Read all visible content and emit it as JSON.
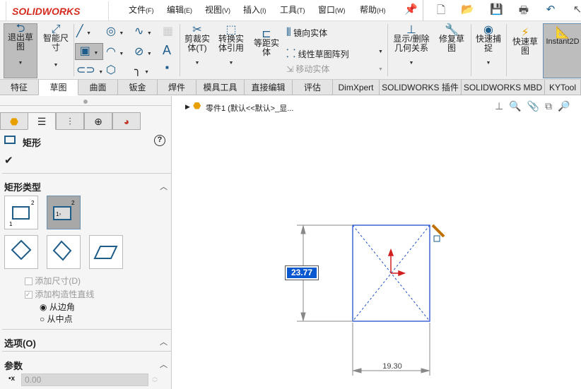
{
  "app": {
    "logo": "SOLIDWORKS"
  },
  "menu": [
    {
      "label": "文件",
      "key": "(F)"
    },
    {
      "label": "编辑",
      "key": "(E)"
    },
    {
      "label": "视图",
      "key": "(V)"
    },
    {
      "label": "插入",
      "key": "(I)"
    },
    {
      "label": "工具",
      "key": "(T)"
    },
    {
      "label": "窗口",
      "key": "(W)"
    },
    {
      "label": "帮助",
      "key": "(H)"
    }
  ],
  "ribbon": {
    "exit_sketch": "退出草图",
    "smart_dim": "智能尺寸",
    "trim": "剪裁实体(T)",
    "convert": "转换实体引用",
    "offset": "等距实体",
    "mirror": "镜向实体",
    "linear_pattern": "线性草图阵列",
    "move": "移动实体",
    "display_relations": "显示/删除几何关系",
    "repair": "修复草图",
    "quick_snaps": "快速捕捉",
    "rapid_sketch": "快速草图",
    "instant2d": "Instant2D"
  },
  "tabs": [
    "特征",
    "草图",
    "曲面",
    "钣金",
    "焊件",
    "模具工具",
    "直接编辑",
    "评估",
    "DimXpert",
    "SOLIDWORKS 插件",
    "SOLIDWORKS MBD",
    "KYTool"
  ],
  "active_tab": "草图",
  "panel": {
    "title": "矩形",
    "section_type": "矩形类型",
    "add_dim": "添加尺寸(D)",
    "add_construction": "添加构造性直线",
    "from_corner": "从边角",
    "from_center": "从中点",
    "options": "选项(O)",
    "params": "参数",
    "x_value": "0.00",
    "help": "?"
  },
  "canvas": {
    "breadcrumb": "零件1  (默认<<默认>_显...",
    "dim_vertical": "23.77",
    "dim_horizontal": "19.30"
  },
  "colors": {
    "sketch": "#1f4fcf",
    "accent": "#1e5c8a",
    "dim_highlight": "#0a58d0"
  }
}
